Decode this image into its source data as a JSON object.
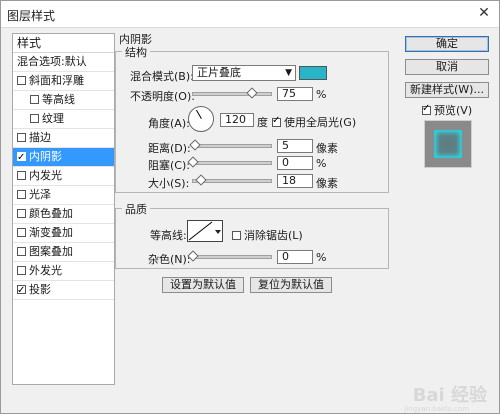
{
  "window": {
    "title": "图层样式",
    "close_glyph": "✕"
  },
  "left_panel": {
    "header": "样式",
    "items": [
      {
        "label": "混合选项:默认",
        "checkbox": false,
        "checked": false,
        "sub": false,
        "selected": false
      },
      {
        "label": "斜面和浮雕",
        "checkbox": true,
        "checked": false,
        "sub": false,
        "selected": false
      },
      {
        "label": "等高线",
        "checkbox": true,
        "checked": false,
        "sub": true,
        "selected": false
      },
      {
        "label": "纹理",
        "checkbox": true,
        "checked": false,
        "sub": true,
        "selected": false
      },
      {
        "label": "描边",
        "checkbox": true,
        "checked": false,
        "sub": false,
        "selected": false
      },
      {
        "label": "内阴影",
        "checkbox": true,
        "checked": true,
        "sub": false,
        "selected": true
      },
      {
        "label": "内发光",
        "checkbox": true,
        "checked": false,
        "sub": false,
        "selected": false
      },
      {
        "label": "光泽",
        "checkbox": true,
        "checked": false,
        "sub": false,
        "selected": false
      },
      {
        "label": "颜色叠加",
        "checkbox": true,
        "checked": false,
        "sub": false,
        "selected": false
      },
      {
        "label": "渐变叠加",
        "checkbox": true,
        "checked": false,
        "sub": false,
        "selected": false
      },
      {
        "label": "图案叠加",
        "checkbox": true,
        "checked": false,
        "sub": false,
        "selected": false
      },
      {
        "label": "外发光",
        "checkbox": true,
        "checked": false,
        "sub": false,
        "selected": false
      },
      {
        "label": "投影",
        "checkbox": true,
        "checked": true,
        "sub": false,
        "selected": false
      }
    ]
  },
  "inner_shadow": {
    "title": "内阴影",
    "structure": {
      "title": "结构",
      "blend_mode_label": "混合模式(B):",
      "blend_mode_value": "正片叠底",
      "shadow_color": "#29b5c8",
      "opacity_label": "不透明度(O):",
      "opacity_value": "75",
      "opacity_unit": "%",
      "opacity_level": 0.75,
      "angle_label": "角度(A):",
      "angle_value": "120",
      "angle_unit": "度",
      "global_light_label": "使用全局光(G)",
      "global_light_checked": true,
      "distance_label": "距离(D):",
      "distance_value": "5",
      "distance_unit": "像素",
      "choke_label": "阻塞(C):",
      "choke_value": "0",
      "choke_unit": "%",
      "size_label": "大小(S):",
      "size_value": "18",
      "size_unit": "像素"
    },
    "quality": {
      "title": "品质",
      "contour_label": "等高线:",
      "antialias_label": "消除锯齿(L)",
      "antialias_checked": false,
      "noise_label": "杂色(N):",
      "noise_value": "0",
      "noise_unit": "%"
    },
    "make_default_label": "设置为默认值",
    "reset_default_label": "复位为默认值"
  },
  "right_panel": {
    "ok_label": "确定",
    "cancel_label": "取消",
    "new_style_label": "新建样式(W)...",
    "preview_label": "预览(V)",
    "preview_checked": true
  },
  "watermark": {
    "text": "Bai 经验",
    "sub": "jingyan.baidu.com"
  }
}
